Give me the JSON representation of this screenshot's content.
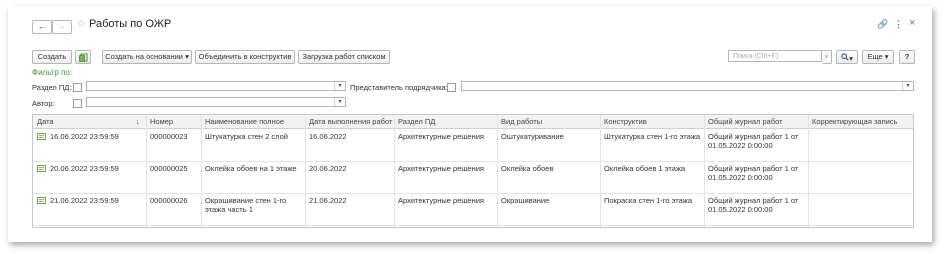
{
  "window": {
    "title": "Работы по ОЖР",
    "back_glyph": "←",
    "forward_glyph": "→",
    "star_glyph": "☆",
    "link_glyph": "🔗",
    "menu_glyph": "⋮",
    "close_glyph": "×"
  },
  "toolbar": {
    "create_label": "Создать",
    "create_based_label": "Создать на основании",
    "dropdown_glyph": "▾",
    "merge_label": "Объединить в конструктив",
    "load_list_label": "Загрузка работ списком",
    "search_placeholder": "Поиск (Ctrl+F)",
    "search_clear_glyph": "×",
    "search_icon_glyph": "🔍",
    "more_label": "Еще",
    "help_label": "?"
  },
  "filters": {
    "title": "Фильтр по:",
    "section_pd_label": "Раздел ПД:",
    "contractor_label": "Представитель подрядчика:",
    "author_label": "Автор:"
  },
  "table": {
    "columns": [
      "Дата",
      "Номер",
      "Наименование полное",
      "Дата выполнения работ",
      "Раздел ПД",
      "Вид работы",
      "Конструктив",
      "Общий журнал работ",
      "Корректирующая запись"
    ],
    "sort_glyph": "↓",
    "rows": [
      {
        "date": "16.06.2022 23:59:59",
        "number": "000000023",
        "name": "Штукатурка стен 2 слой",
        "done_date": "16.06.2022",
        "section": "Архитектурные решения",
        "work_type": "Оштукатуривание",
        "construct": "Штукатурка стен 1-го этажа",
        "journal": "Общий журнал работ 1 от 01.05.2022 0:00:00",
        "correction": ""
      },
      {
        "date": "20.06.2022 23:59:59",
        "number": "000000025",
        "name": "Оклейка обоев на 1 этаже",
        "done_date": "20.06.2022",
        "section": "Архитектурные решения",
        "work_type": "Оклейка обоев",
        "construct": "Оклейка обоев 1 этажа",
        "journal": "Общий журнал работ 1 от 01.05.2022 0:00:00",
        "correction": ""
      },
      {
        "date": "21.06.2022 23:59:59",
        "number": "000000026",
        "name": "Окрашивание стен 1-го этажа часть 1",
        "done_date": "21.06.2022",
        "section": "Архитектурные решения",
        "work_type": "Окрашивание",
        "construct": "Покраска стен 1-го этажа",
        "journal": "Общий журнал работ 1 от 01.05.2022 0:00:00",
        "correction": ""
      }
    ]
  }
}
